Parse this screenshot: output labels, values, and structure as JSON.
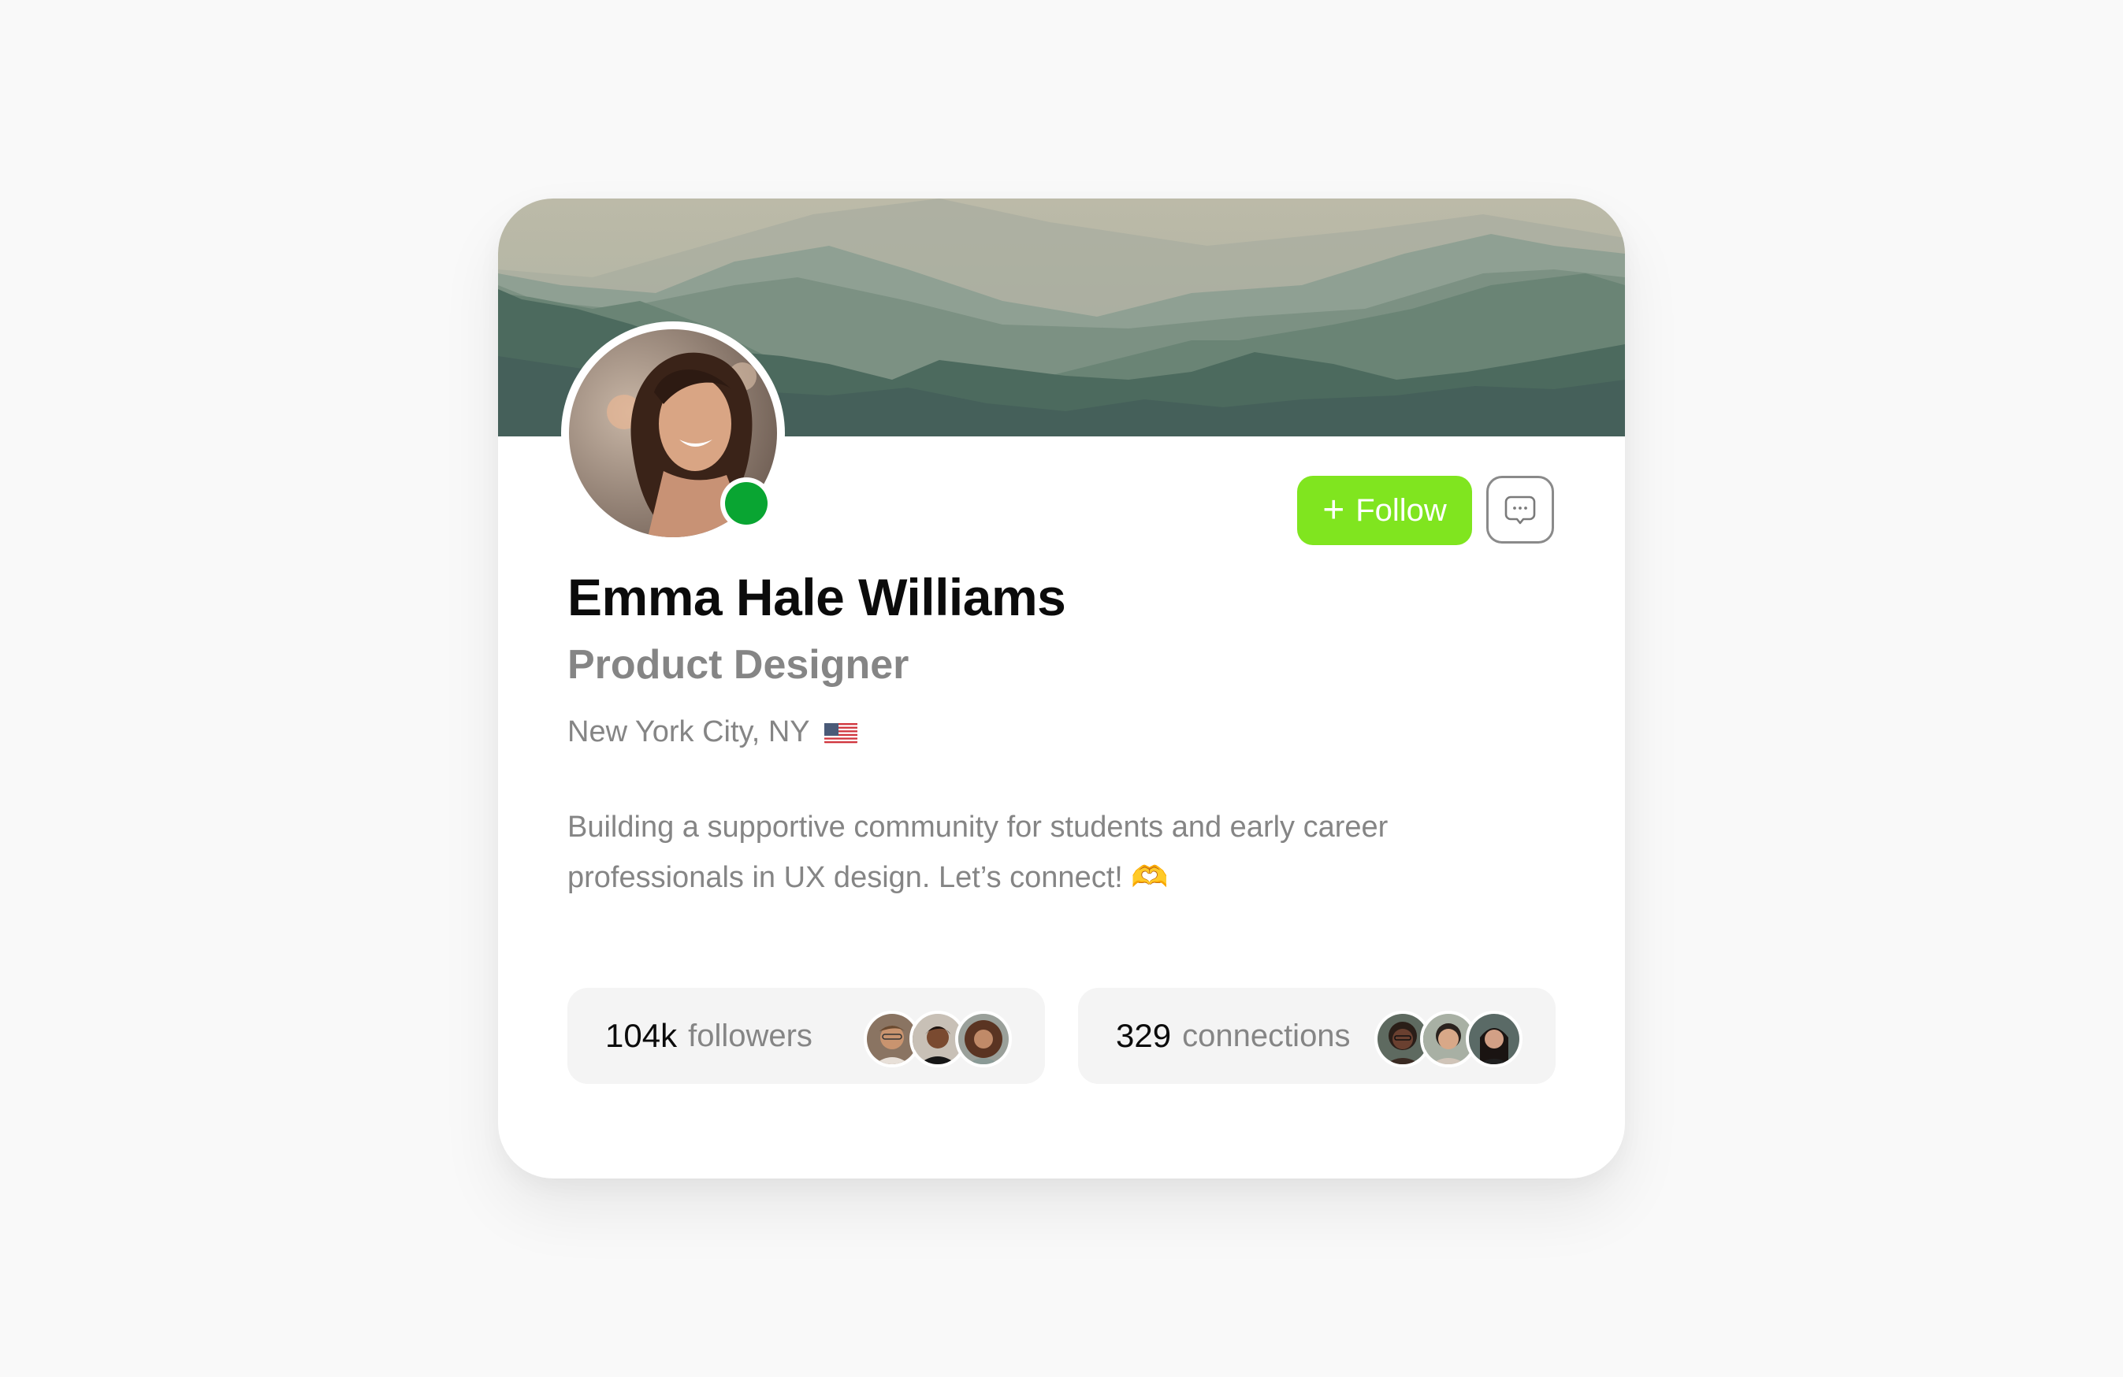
{
  "profile": {
    "name": "Emma Hale Williams",
    "role": "Product Designer",
    "location": "New York City, NY",
    "location_flag_icon": "us-flag-icon",
    "bio": "Building a supportive community for students and early career professionals in UX design. Let’s connect! 🫶",
    "bio_emoji_icon": "heart-hands-icon",
    "status": "online",
    "status_color": "#09a532"
  },
  "actions": {
    "follow_label": "Follow",
    "follow_icon": "plus-icon",
    "follow_color": "#80e51f",
    "message_icon": "chat-bubble-icon"
  },
  "stats": [
    {
      "value": "104k",
      "label": "followers",
      "avatars": [
        "follower-avatar-1",
        "follower-avatar-2",
        "follower-avatar-3"
      ]
    },
    {
      "value": "329",
      "label": "connections",
      "avatars": [
        "connection-avatar-1",
        "connection-avatar-2",
        "connection-avatar-3"
      ]
    }
  ],
  "banner": {
    "theme": "misty-mountains"
  }
}
